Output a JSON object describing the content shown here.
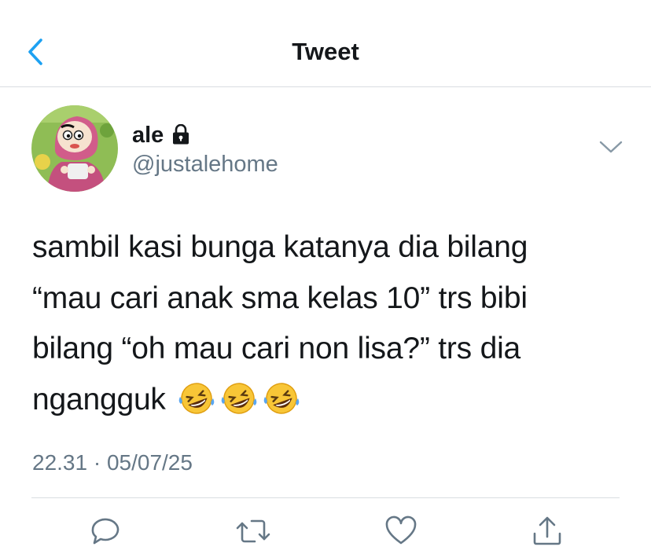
{
  "header": {
    "title": "Tweet",
    "back_icon": "chevron-left-icon",
    "accent": "#1da1f2"
  },
  "author": {
    "name": "ale",
    "handle": "@justalehome",
    "protected_icon": "lock-icon",
    "menu_icon": "chevron-down-icon"
  },
  "tweet": {
    "lines": [
      "sambil kasi bunga katanya dia bilang",
      "“mau cari anak sma kelas 10” trs bibi",
      "bilang “oh mau cari non lisa?” trs dia",
      "ngangguk"
    ],
    "emoji": [
      "🤣",
      "🤣",
      "🤣"
    ],
    "emoji_name": "rolling-on-the-floor-laughing"
  },
  "meta": {
    "timestamp": "22.31 · 05/07/25"
  },
  "actions": [
    "reply-icon",
    "retweet-icon",
    "like-icon",
    "share-icon"
  ],
  "colors": {
    "text": "#14171a",
    "secondary": "#657786",
    "divider": "#d9dde1"
  }
}
